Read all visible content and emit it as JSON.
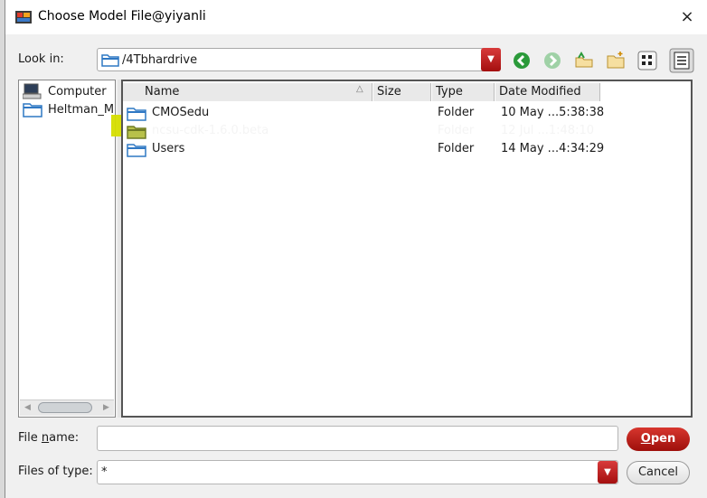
{
  "window": {
    "title": "Choose Model File@yiyanli",
    "close_glyph": "×"
  },
  "look_in": {
    "label": "Look in:",
    "path": "/4Tbhardrive"
  },
  "toolbar": {
    "icons": [
      "back-icon",
      "forward-icon",
      "parent-folder-icon",
      "new-folder-icon",
      "list-view-icon",
      "detail-view-icon"
    ],
    "accent": "#c0201b"
  },
  "places": [
    {
      "label": "Computer",
      "icon": "computer-icon"
    },
    {
      "label": "Heltman_M",
      "icon": "folder-icon"
    }
  ],
  "columns": {
    "name": "Name",
    "size": "Size",
    "type": "Type",
    "date_modified": "Date Modified"
  },
  "files": [
    {
      "name": "CMOSedu",
      "type": "Folder",
      "date": "10 May ...5:38:38"
    },
    {
      "name": "ncsu-cdk-1.6.0.beta",
      "type": "Folder",
      "date": "12 Jul ...1:48:10"
    },
    {
      "name": "Users",
      "type": "Folder",
      "date": "14 May ...4:34:29"
    }
  ],
  "highlight_color": "#d6de00",
  "file_name": {
    "label_pre": "File ",
    "label_mnemonic": "n",
    "label_post": "ame:",
    "value": ""
  },
  "files_of_type": {
    "label": "Files of type:",
    "value": "*"
  },
  "buttons": {
    "open_mnemonic": "O",
    "open_rest": "pen",
    "cancel": "Cancel"
  }
}
